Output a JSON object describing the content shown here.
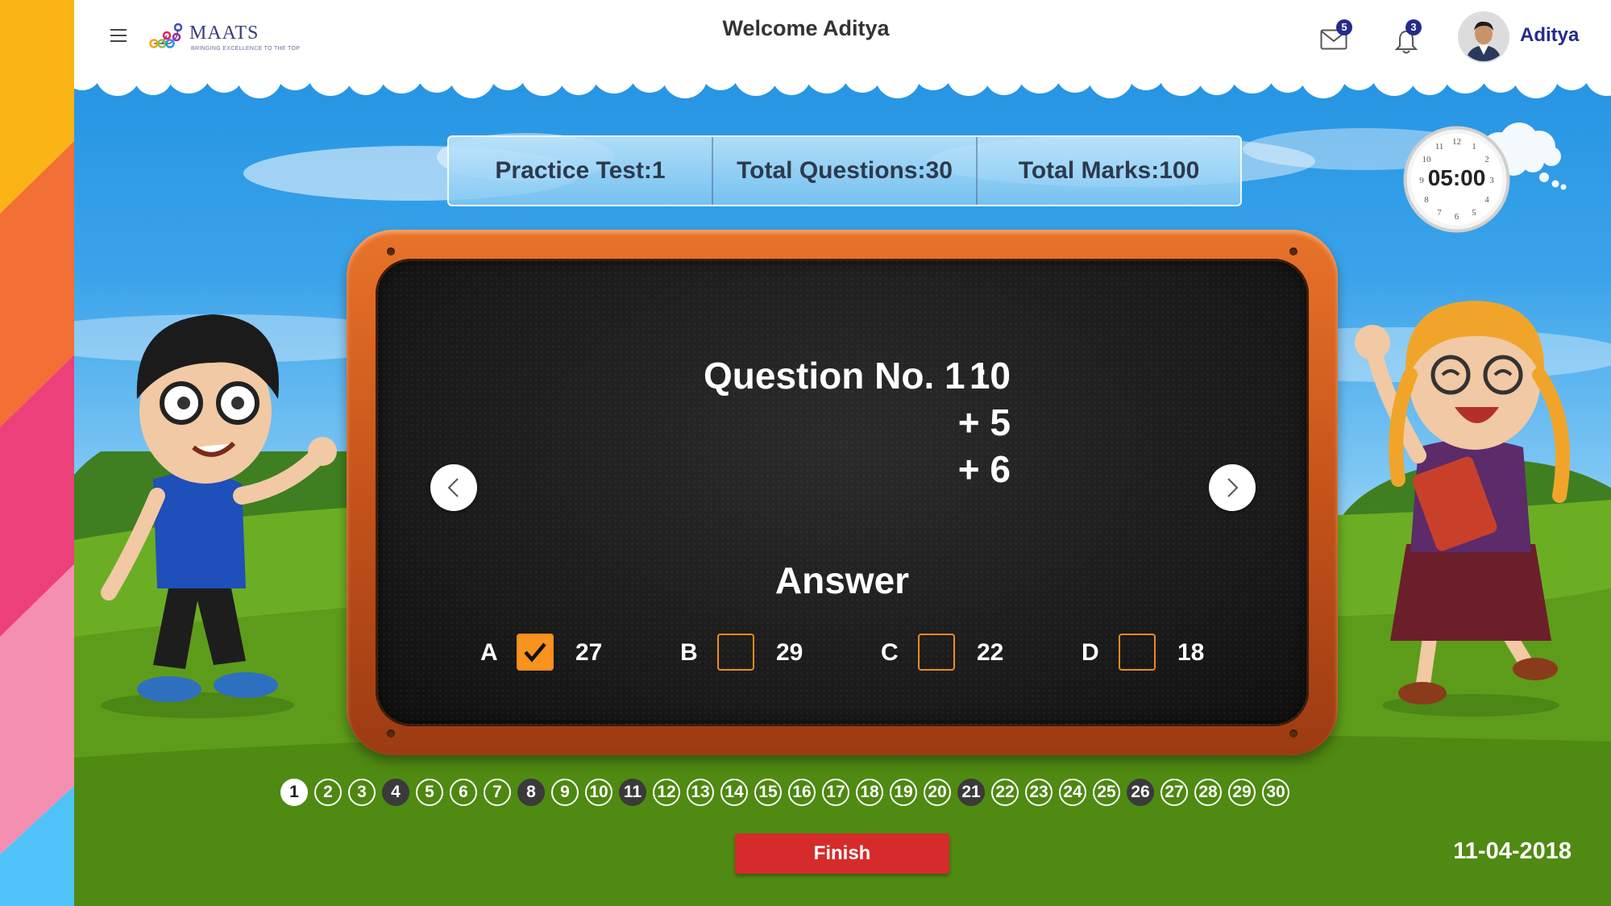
{
  "header": {
    "welcome": "Welcome Aditya",
    "logo_name": "MAATS",
    "logo_tagline": "BRINGING EXCELLENCE TO THE TOP",
    "mail_count": "5",
    "notification_count": "3",
    "username": "Aditya"
  },
  "test_info": {
    "practice_test": "Practice Test:1",
    "total_questions": "Total Questions:30",
    "total_marks": "Total Marks:100"
  },
  "clock": {
    "time": "05:00"
  },
  "question": {
    "label": "Question No. 1 :",
    "lines": [
      "10",
      "+ 5",
      "+ 6"
    ]
  },
  "answer": {
    "title": "Answer",
    "options": [
      {
        "letter": "A",
        "value": "27",
        "checked": true
      },
      {
        "letter": "B",
        "value": "29",
        "checked": false
      },
      {
        "letter": "C",
        "value": "22",
        "checked": false
      },
      {
        "letter": "D",
        "value": "18",
        "checked": false
      }
    ]
  },
  "pagination": {
    "pages": [
      "1",
      "2",
      "3",
      "4",
      "5",
      "6",
      "7",
      "8",
      "9",
      "10",
      "11",
      "12",
      "13",
      "14",
      "15",
      "16",
      "17",
      "18",
      "19",
      "20",
      "21",
      "22",
      "23",
      "24",
      "25",
      "26",
      "27",
      "28",
      "29",
      "30"
    ],
    "current": "1",
    "answered": [
      "4",
      "8",
      "11",
      "21",
      "26"
    ]
  },
  "footer": {
    "finish_label": "Finish",
    "date": "11-04-2018"
  },
  "colors": {
    "accent_orange": "#f7931e",
    "finish_red": "#d62b2b",
    "brand_navy": "#252b8a"
  }
}
